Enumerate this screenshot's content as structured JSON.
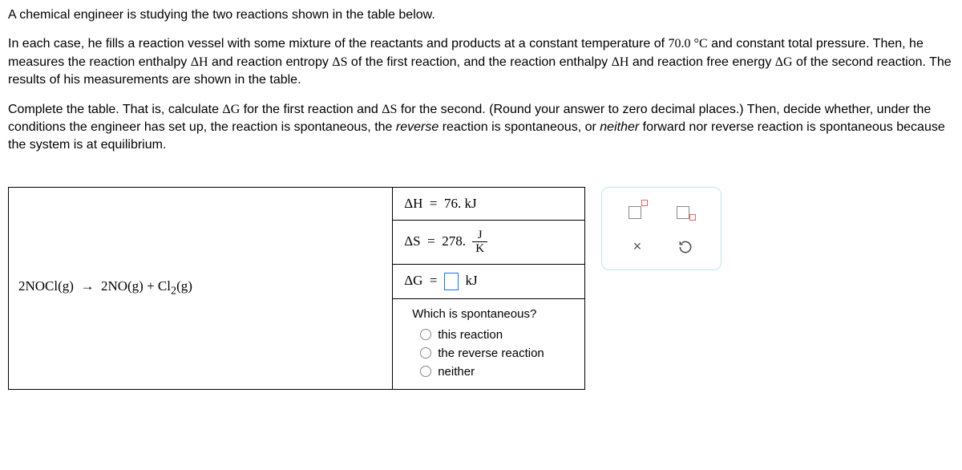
{
  "intro": {
    "p1": "A chemical engineer is studying the two reactions shown in the table below.",
    "p2_a": "In each case, he fills a reaction vessel with some mixture of the reactants and products at a constant temperature of ",
    "p2_temp": "70.0 °C",
    "p2_b": " and constant total pressure. Then, he measures the reaction enthalpy ",
    "dH": "ΔH",
    "p2_c": " and reaction entropy ",
    "dS": "ΔS",
    "p2_d": " of the first reaction, and the reaction enthalpy ",
    "p2_e": " and reaction free energy ",
    "dG": "ΔG",
    "p2_f": " of the second reaction. The results of his measurements are shown in the table.",
    "p3_a": "Complete the table. That is, calculate ",
    "p3_b": " for the first reaction and ",
    "p3_c": " for the second. (Round your answer to zero decimal places.) Then, decide whether, under the conditions the engineer has set up, the reaction is spontaneous, the ",
    "reverse": "reverse",
    "p3_d": " reaction is spontaneous, or ",
    "neither": "neither",
    "p3_e": " forward nor reverse reaction is spontaneous because the system is at equilibrium."
  },
  "reaction1": {
    "equation_left": "2NOCl(g)",
    "arrow": "→",
    "equation_right_a": "2NO(g) + Cl",
    "equation_right_sub": "2",
    "equation_right_b": "(g)",
    "dH_label": "ΔH",
    "eq": "=",
    "dH_val": "76. kJ",
    "dS_label": "ΔS",
    "dS_val": "278.",
    "frac_num": "J",
    "frac_den": "K",
    "dG_label": "ΔG",
    "dG_unit": "kJ"
  },
  "question": {
    "title": "Which is spontaneous?",
    "opt1": "this reaction",
    "opt2": "the reverse reaction",
    "opt3": "neither"
  },
  "tools": {
    "clear": "×"
  }
}
